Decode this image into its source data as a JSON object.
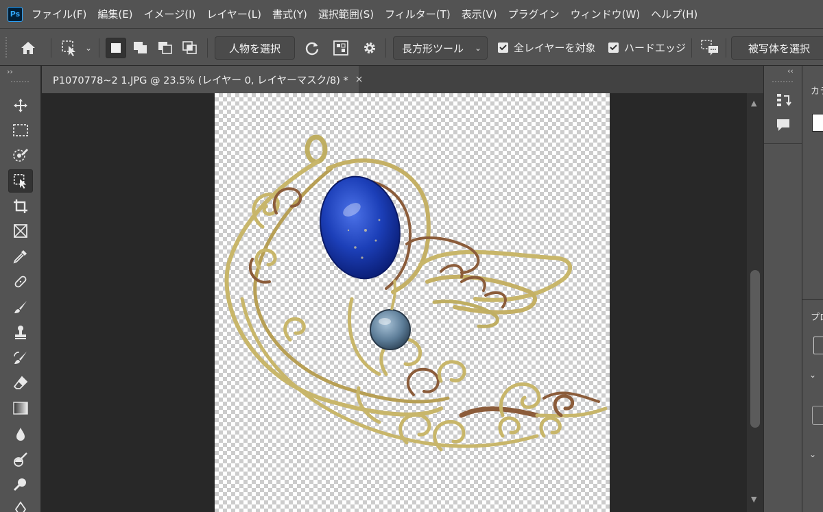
{
  "app": {
    "logo": "Ps"
  },
  "menu": [
    "ファイル(F)",
    "編集(E)",
    "イメージ(I)",
    "レイヤー(L)",
    "書式(Y)",
    "選択範囲(S)",
    "フィルター(T)",
    "表示(V)",
    "プラグイン",
    "ウィンドウ(W)",
    "ヘルプ(H)"
  ],
  "options": {
    "select_subject_button": "人物を選択",
    "mode_dropdown": "長方形ツール",
    "sample_all_layers": {
      "label": "全レイヤーを対象",
      "checked": true
    },
    "hard_edge": {
      "label": "ハードエッジ",
      "checked": true
    },
    "select_object_button": "被写体を選択"
  },
  "toolbar_collapse": "››",
  "right_collapse": "‹‹",
  "document": {
    "tab_title": "P1070778~2 1.JPG @ 23.5% (レイヤー 0, レイヤーマスク/8) *",
    "close_icon": "×"
  },
  "right_panel": {
    "color_tab_label": "カラ",
    "properties_tab_label": "プロ"
  },
  "icons": {
    "home": "home-icon",
    "object_selection": "object-selection-icon",
    "rectangle_mode": "rectangle-mode-icon",
    "refresh": "refresh-icon",
    "mask": "mask-icon",
    "gear": "gear-icon",
    "comment": "comment-icon"
  },
  "colors": {
    "ui_panel": "#535353",
    "canvas_bg": "#282828",
    "accent": "#31a8ff",
    "lapis": "#1c3fb8",
    "wire_gold": "#c8b66a"
  }
}
